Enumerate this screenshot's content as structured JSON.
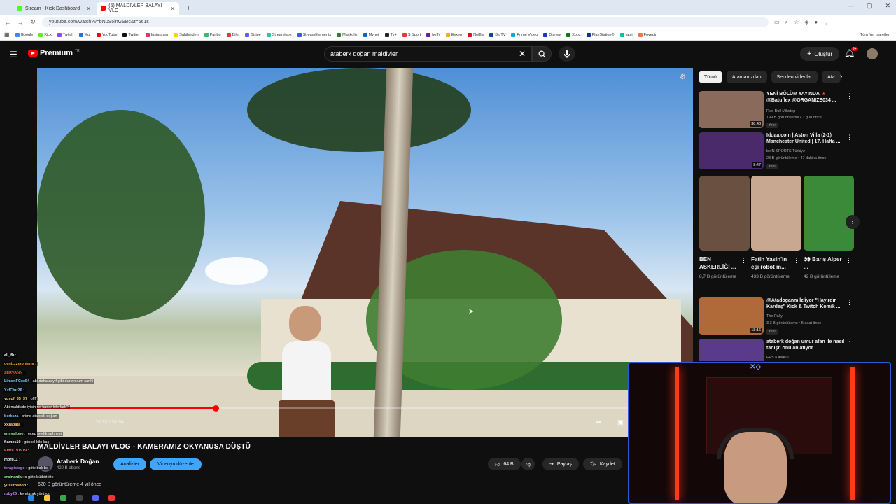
{
  "browser": {
    "tabs": [
      {
        "title": "Stream - Kick Dashboard",
        "color": "#53fc18",
        "active": false
      },
      {
        "title": "(5) MALDIVLER BALAYI VLO",
        "color": "#ff0000",
        "active": true
      }
    ],
    "url": "youtube.com/watch?v=bN0S5lnGSBc&t=661s",
    "bookmarks": [
      {
        "label": "Google",
        "color": "#4285f4"
      },
      {
        "label": "Kick",
        "color": "#53fc18"
      },
      {
        "label": "Twitch",
        "color": "#9146ff"
      },
      {
        "label": "Kur",
        "color": "#1a73e8"
      },
      {
        "label": "YouTube",
        "color": "#ff0000"
      },
      {
        "label": "Twitter",
        "color": "#111111"
      },
      {
        "label": "Instagram",
        "color": "#e1306c"
      },
      {
        "label": "Sahibinden",
        "color": "#ffd400"
      },
      {
        "label": "Paribu",
        "color": "#2fbf71"
      },
      {
        "label": "Bilet",
        "color": "#e53935"
      },
      {
        "label": "Stripe",
        "color": "#635bff"
      },
      {
        "label": "Streamlabs",
        "color": "#31c3a2"
      },
      {
        "label": "StreamElements",
        "color": "#3a5bd9"
      },
      {
        "label": "Maçkolik",
        "color": "#2e7d32"
      },
      {
        "label": "Mynet",
        "color": "#1565c0"
      },
      {
        "label": "Tv+",
        "color": "#222222"
      },
      {
        "label": "S Sport",
        "color": "#e53935"
      },
      {
        "label": "beIN",
        "color": "#6a1b9a"
      },
      {
        "label": "Exxen",
        "color": "#f9a825"
      },
      {
        "label": "Netflix",
        "color": "#e50914"
      },
      {
        "label": "BluTV",
        "color": "#0d47a1"
      },
      {
        "label": "Prime Video",
        "color": "#00a8e1"
      },
      {
        "label": "Disney",
        "color": "#113ccf"
      },
      {
        "label": "Xbox",
        "color": "#107c10"
      },
      {
        "label": "PlayStation®",
        "color": "#003791"
      },
      {
        "label": "tabii",
        "color": "#00c2a8"
      },
      {
        "label": "Fovepin",
        "color": "#ff7043"
      }
    ],
    "bookmarks_right": "Tüm Yer İşaretleri"
  },
  "youtube": {
    "logo": "Premium",
    "logo_tr": "TR",
    "search_value": "ataberk doğan maldivler",
    "create_label": "Oluştur",
    "notif_count": "9+"
  },
  "video": {
    "title": "MALDİVLER BALAYI VLOG - KAMERAMIZ OKYANUSA DÜŞTÜ",
    "timecode": "10:33 / 34:54",
    "progress": 0.302,
    "channel": "Ataberk Doğan",
    "subs": "420 B abone",
    "analytics_label": "Analizler",
    "edit_label": "Videoyu düzenle",
    "likes": "64 B",
    "share_label": "Paylaş",
    "save_label": "Kaydet",
    "meta": "620 B görüntüleme  4 yıl önce"
  },
  "chips": [
    "Tümü",
    "Aramanızdan",
    "Seriden videolar",
    "Ata"
  ],
  "recommendations": [
    {
      "title": "YENİ BÖLÜM YAYINDA 🔺 @Batuflex @ORGANIZE034 ...",
      "channel": "Red Bull Mikstep",
      "views": "199 B görüntüleme • 1 gün önce",
      "badge": "Yeni",
      "duration": "38:43",
      "color": "#8a6a5a"
    },
    {
      "title": "Iddaa.com | Aston Villa (2-1) Manchester United | 17. Hafta ...",
      "channel": "beIN SPORTS Türkiye",
      "views": "23 B görüntüleme • 47 dakika önce",
      "badge": "Yeni",
      "duration": "8:47",
      "color": "#4a2a6a"
    },
    {
      "title": "@Atadoganm İzliyor \"Hayırdır Kardeş\" Kick & Twitch Komik ...",
      "channel": "The Pally",
      "views": "3,3 B görüntüleme • 5 saat önce",
      "badge": "Yeni",
      "duration": "18:16",
      "color": "#b06a3a"
    },
    {
      "title": "ataberk doğan umur afan ile nasıl tanıştı onu anlatıyor",
      "channel": "FPS KANALI",
      "views": "",
      "badge": "",
      "duration": "",
      "color": "#5a3a8a"
    }
  ],
  "shorts": [
    {
      "title": "BEN ASKERLİĞİ ...",
      "views": "8,7 B görüntüleme",
      "color": "#6a5040"
    },
    {
      "title": "Fatih Yasin'in eşi robot m...",
      "views": "433 B görüntüleme",
      "color": "#c8a890"
    },
    {
      "title": "👀 Barış Alper ...",
      "views": "42 B görüntüleme",
      "color": "#3a8a3a"
    }
  ],
  "chat": [
    {
      "user": "all_fb",
      "msg": "",
      "color": "#ffffff"
    },
    {
      "user": "denizzzmontana",
      "msg": "",
      "color": "#ff9f1a"
    },
    {
      "user": "ZERVANN",
      "msg": "",
      "color": "#ff4d4d"
    },
    {
      "user": "LimonFCcc54",
      "msg": "abi daha zayıf gibi duruyorum sanki",
      "color": "#7cd1ff"
    },
    {
      "user": "YzfCtnr26",
      "msg": "",
      "color": "#7cd1ff"
    },
    {
      "user": "yusuf_35_37",
      "msg": "offff",
      "color": "#ffd166"
    },
    {
      "user": "",
      "msg": "Abi maldivde iyisin ne kadar kilo fark?",
      "color": "#c58cff"
    },
    {
      "user": "berksza",
      "msg": "prime ataberk doğan",
      "color": "#7cd1ff"
    },
    {
      "user": "xxzapata",
      "msg": "",
      "color": "#ffd166"
    },
    {
      "user": "emrealone",
      "msg": "recep ivedik sahnesi",
      "color": "#9eff9e"
    },
    {
      "user": "flames10",
      "msg": "güncel kilo kaç",
      "color": "#ffffff"
    },
    {
      "user": "Emre191919",
      "msg": "",
      "color": "#ff6b6b"
    },
    {
      "user": "morb11",
      "msg": "",
      "color": "#ffffff"
    },
    {
      "user": "terapistego",
      "msg": "göte bak be",
      "color": "#c58cff"
    },
    {
      "user": "ersinarda",
      "msg": "o göte bütbüt öte",
      "color": "#9eff9e"
    },
    {
      "user": "yusufbabod",
      "msg": "",
      "color": "#ffd166"
    },
    {
      "user": "roby26",
      "msg": "kıvırtarak yürüyor",
      "color": "#c58cff"
    }
  ]
}
